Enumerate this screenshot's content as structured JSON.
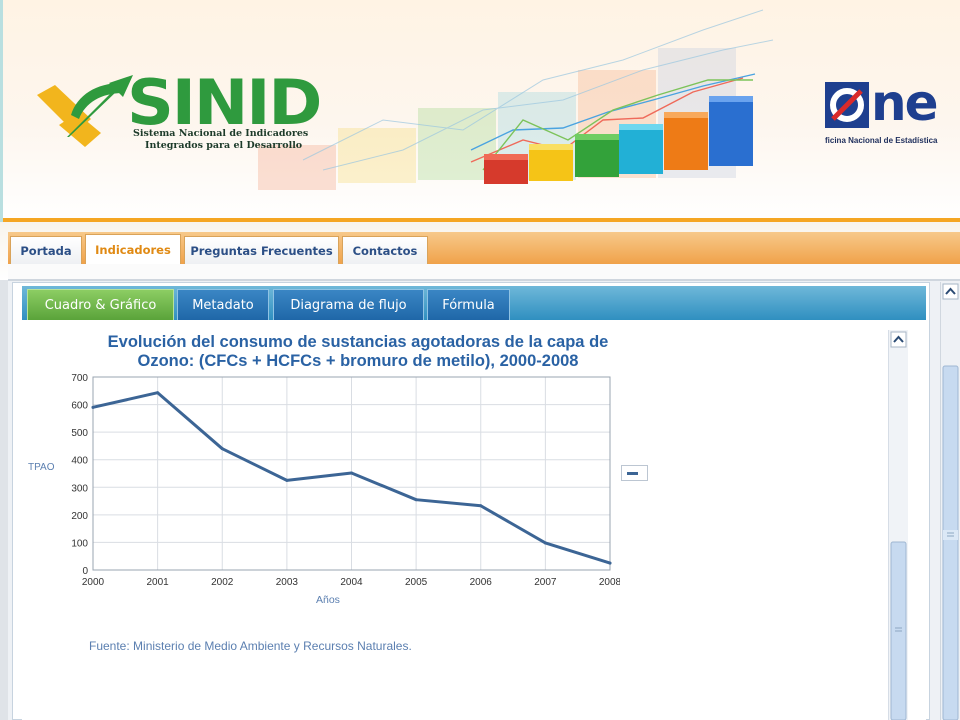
{
  "header": {
    "logo_text": "SINID",
    "logo_subtitle_line1": "Sistema Nacional de Indicadores",
    "logo_subtitle_line2": "Integrados para el Desarrollo",
    "one_logo_text": "ne",
    "one_subtitle": "ficina Nacional de Estadística"
  },
  "nav": {
    "tabs": [
      {
        "label": "Portada"
      },
      {
        "label": "Indicadores"
      },
      {
        "label": "Preguntas Frecuentes"
      },
      {
        "label": "Contactos"
      }
    ],
    "active_tab": "Indicadores"
  },
  "content_tabs": {
    "tabs": [
      {
        "label": "Cuadro & Gráfico"
      },
      {
        "label": "Metadato"
      },
      {
        "label": "Diagrama de flujo"
      },
      {
        "label": "Fórmula"
      }
    ],
    "active_tab": "Cuadro & Gráfico"
  },
  "chart_data": {
    "type": "line",
    "title": "Evolución del consumo de sustancias agotadoras de la capa de Ozono: (CFCs + HCFCs + bromuro de metilo), 2000-2008",
    "title_line1": "Evolución del consumo de sustancias agotadoras de la capa de",
    "title_line2": "Ozono: (CFCs + HCFCs + bromuro de metilo), 2000-2008",
    "xlabel": "Años",
    "ylabel": "TPAO",
    "x": [
      "2000",
      "2001",
      "2002",
      "2003",
      "2004",
      "2005",
      "2006",
      "2007",
      "2008"
    ],
    "series": [
      {
        "values": [
          590,
          643,
          440,
          325,
          352,
          255,
          233,
          98,
          25
        ],
        "color": "#3c6595"
      }
    ],
    "ylim": [
      0,
      700
    ],
    "yticks": [
      0,
      100,
      200,
      300,
      400,
      500,
      600,
      700
    ],
    "grid": true,
    "legend": "right"
  },
  "source_text": "Fuente: Ministerio de Medio Ambiente y Recursos Naturales.",
  "colors": {
    "nav_orange": "#f0a24a",
    "active_nav_text": "#e08a14",
    "tab_blue": "#2f8fc0",
    "tab_active_green": "#5aa33a",
    "title_blue": "#2a62a4",
    "series_blue": "#3c6595"
  }
}
